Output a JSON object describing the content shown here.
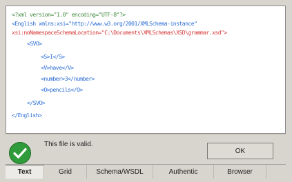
{
  "editor": {
    "lines": [
      {
        "kind": "pi",
        "text": "<?xml version=\"1.0\" encoding=\"UTF-8\"?>"
      },
      {
        "kind": "tag",
        "text": "<English xmlns:xsi=\"http://www.w3.org/2001/XMLSchema-instance\""
      },
      {
        "kind": "attr",
        "text": "xsi:noNamespaceSchemaLocation=\"C:\\Documents\\XMLSchemas\\XSD\\grammar.xsd\">"
      },
      {
        "kind": "tag",
        "text": "<SVO>"
      },
      {
        "kind": "tag",
        "text": "<S>I</S>"
      },
      {
        "kind": "tag",
        "text": "<V>have</V>"
      },
      {
        "kind": "tag",
        "text": "<number>3</number>"
      },
      {
        "kind": "tag",
        "text": "<O>pencils</O>"
      },
      {
        "kind": "tag",
        "text": "</SVO>"
      },
      {
        "kind": "tag",
        "text": "</English>"
      }
    ]
  },
  "status": {
    "message": "This file is valid.",
    "ok_label": "OK",
    "icon": "checkmark-icon",
    "icon_color": "#2f9b3a"
  },
  "tabs": [
    {
      "label": "Text",
      "active": true
    },
    {
      "label": "Grid",
      "active": false
    },
    {
      "label": "Schema/WSDL",
      "active": false
    },
    {
      "label": "Authentic",
      "active": false
    },
    {
      "label": "Browser",
      "active": false
    }
  ]
}
